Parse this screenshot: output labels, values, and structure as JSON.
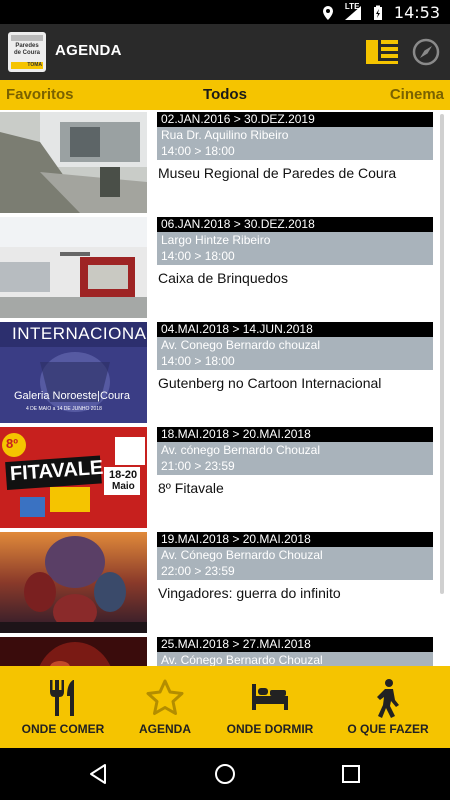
{
  "status_bar": {
    "time": "14:53",
    "network": "LTE",
    "icons": [
      "location-icon",
      "signal-icon",
      "battery-charging-icon"
    ]
  },
  "app_bar": {
    "logo_text": "Paredes de Coura",
    "logo_badge": "TOMA",
    "title": "AGENDA",
    "icons": [
      "list-view-icon",
      "compass-icon"
    ]
  },
  "tabs": {
    "left": "Favoritos",
    "center": "Todos",
    "right": "Cinema"
  },
  "events": [
    {
      "date": "02.JAN.2016 > 30.DEZ.2019",
      "address": "Rua Dr. Aquilino Ribeiro",
      "hours": "14:00 > 18:00",
      "name": "Museu Regional de Paredes de Coura"
    },
    {
      "date": "06.JAN.2018 > 30.DEZ.2018",
      "address": "Largo Hintze Ribeiro",
      "hours": "14:00 > 18:00",
      "name": "Caixa de Brinquedos"
    },
    {
      "date": "04.MAI.2018 > 14.JUN.2018",
      "address": "Av. Conego Bernardo chouzal",
      "hours": "14:00 > 18:00",
      "name": "Gutenberg no Cartoon Internacional",
      "thumb_title": "INTERNACIONAL",
      "thumb_sub": "Galeria Noroeste|Coura",
      "thumb_date": "4 DE MAIO a 14 DE JUNHO 2018"
    },
    {
      "date": "18.MAI.2018 > 20.MAI.2018",
      "address": "Av. cónego Bernardo Chouzal",
      "hours": "21:00 > 23:59",
      "name": "8º Fitavale",
      "thumb_title": "FITAVALE",
      "thumb_badge": "8º",
      "thumb_dates": "18-20",
      "thumb_month": "Maio"
    },
    {
      "date": "19.MAI.2018 > 20.MAI.2018",
      "address": "Av. Cónego Bernardo Chouzal",
      "hours": "22:00 > 23:59",
      "name": "Vingadores: guerra do infinito"
    },
    {
      "date": "25.MAI.2018 > 27.MAI.2018",
      "address": "Av. Cónego Bernardo Chouzal",
      "hours": "",
      "name": ""
    }
  ],
  "bottom_nav": [
    {
      "label": "ONDE COMER",
      "icon": "fork-knife-icon"
    },
    {
      "label": "AGENDA",
      "icon": "star-icon"
    },
    {
      "label": "ONDE DORMIR",
      "icon": "bed-icon"
    },
    {
      "label": "O QUE FAZER",
      "icon": "hiker-icon"
    }
  ],
  "colors": {
    "accent": "#f5c400",
    "app_bar": "#2a2a2a",
    "date_bar": "#000000",
    "address_box": "#a9b3bb"
  }
}
